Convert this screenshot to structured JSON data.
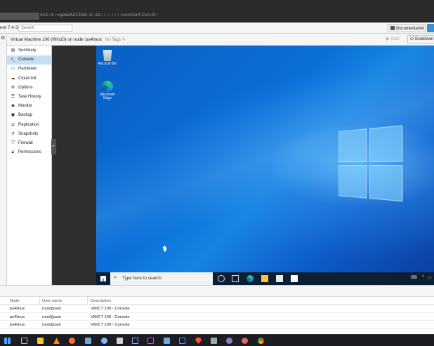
{
  "browser": {
    "url": "#v1:0:=qemu%2F100:4:11::::::::contentIso:8:"
  },
  "pve": {
    "version_label": "ent 7.4-3",
    "search_placeholder": "Search",
    "documentation_label": "Documentation"
  },
  "vm": {
    "title": "Virtual Machine 100 (Win10) on node 'ps4linux'",
    "tags": "No Tags",
    "start_label": "Start",
    "shutdown_label": "Shutdown"
  },
  "nav": {
    "items": [
      {
        "label": "Summary",
        "icon": "summary-icon"
      },
      {
        "label": "Console",
        "icon": "console-icon"
      },
      {
        "label": "Hardware",
        "icon": "hardware-icon"
      },
      {
        "label": "Cloud-Init",
        "icon": "cloud-icon"
      },
      {
        "label": "Options",
        "icon": "gear-icon"
      },
      {
        "label": "Task History",
        "icon": "list-icon"
      },
      {
        "label": "Monitor",
        "icon": "eye-icon"
      },
      {
        "label": "Backup",
        "icon": "floppy-icon"
      },
      {
        "label": "Replication",
        "icon": "retweet-icon"
      },
      {
        "label": "Snapshots",
        "icon": "history-icon"
      },
      {
        "label": "Firewall",
        "icon": "shield-icon"
      },
      {
        "label": "Permissions",
        "icon": "unlock-icon"
      }
    ],
    "active": "Console"
  },
  "desktop": {
    "icons": [
      {
        "label": "Recycle Bin"
      },
      {
        "label": "Microsoft Edge"
      }
    ],
    "taskbar_search_placeholder": "Type here to search"
  },
  "tasks": {
    "headers": [
      "Node",
      "User name",
      "Description"
    ],
    "rows": [
      {
        "node": "ps4linux",
        "user": "root@pam",
        "desc": "VM/CT 100 - Console"
      },
      {
        "node": "ps4linux",
        "user": "root@pam",
        "desc": "VM/CT 100 - Console"
      },
      {
        "node": "ps4linux",
        "user": "root@pam",
        "desc": "VM/CT 100 - Console"
      }
    ]
  },
  "colors": {
    "accent": "#3892d4",
    "selected_nav": "#c6dff4",
    "desktop_blue": "#0a6fd8"
  }
}
